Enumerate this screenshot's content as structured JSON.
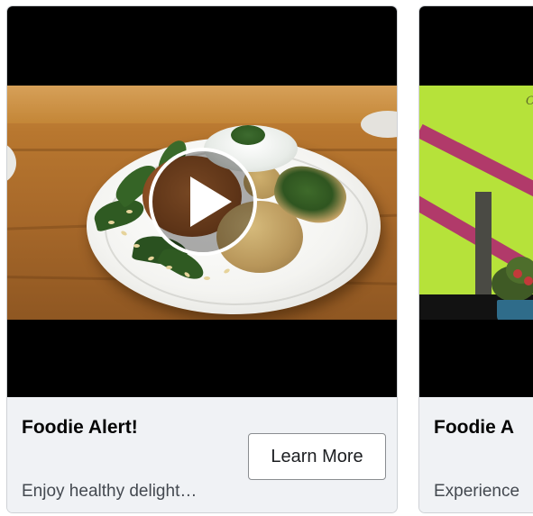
{
  "cards": [
    {
      "title": "Foodie Alert!",
      "description": "Enjoy healthy delight…",
      "cta_label": "Learn More",
      "media": "video",
      "play_icon": "play-icon"
    },
    {
      "title": "Foodie A",
      "description": "Experience",
      "wall_text": "C"
    }
  ],
  "colors": {
    "card_background": "#f0f2f5",
    "card_border": "#cfd2d6",
    "title_text": "#050505",
    "description_text": "#444950",
    "button_border": "#8a8d91",
    "video_letterbox": "#000000"
  }
}
